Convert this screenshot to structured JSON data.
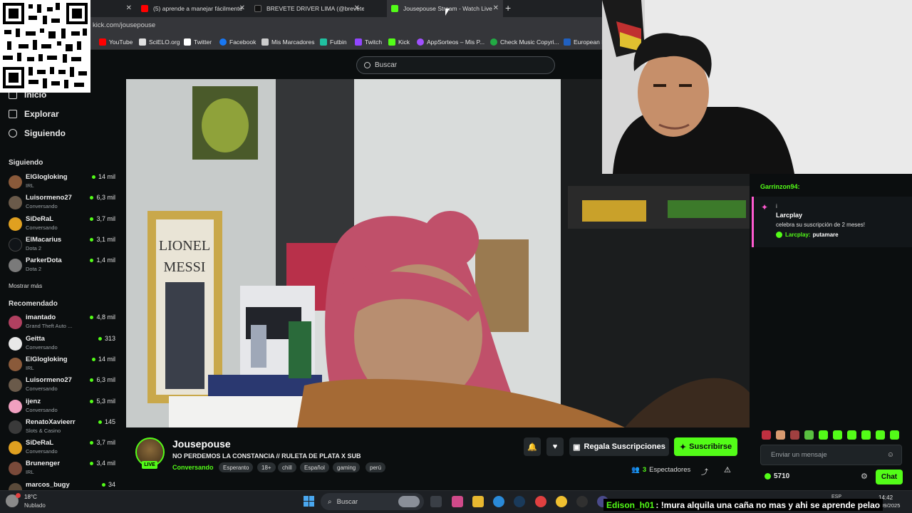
{
  "browser": {
    "tabs": [
      {
        "label": "",
        "favicon_color": "#888888"
      },
      {
        "label": "(5) aprende a manejar fácilmente",
        "favicon_color": "#ff0000"
      },
      {
        "label": "BREVETE DRIVER LIMA (@brevete",
        "favicon_color": "#111111"
      },
      {
        "label": "Jousepouse Stream - Watch Live",
        "favicon_color": "#53fc18",
        "active": true
      }
    ],
    "url": "kick.com/jousepouse",
    "bookmarks": [
      {
        "label": "YouTube",
        "color": "#ff0000"
      },
      {
        "label": "SciELO.org",
        "color": "#e0e0e0"
      },
      {
        "label": "Twitter",
        "color": "#ffffff"
      },
      {
        "label": "Facebook",
        "color": "#1877f2"
      },
      {
        "label": "Mis Marcadores",
        "color": "#cccccc"
      },
      {
        "label": "Futbin",
        "color": "#20c0a0"
      },
      {
        "label": "Twitch",
        "color": "#9146ff"
      },
      {
        "label": "Kick",
        "color": "#53fc18"
      },
      {
        "label": "AppSorteos – Mis P...",
        "color": "#a050ff"
      },
      {
        "label": "Check Music Copyri...",
        "color": "#22aa44"
      },
      {
        "label": "European E",
        "color": "#2060c0"
      }
    ]
  },
  "search": {
    "placeholder": "Buscar"
  },
  "sidebar": {
    "nav": [
      {
        "label": "Inicio",
        "icon": "home-icon"
      },
      {
        "label": "Explorar",
        "icon": "compass-icon"
      },
      {
        "label": "Siguiendo",
        "icon": "heart-icon"
      }
    ],
    "following_title": "Siguiendo",
    "following": [
      {
        "name": "ElGlogloking",
        "category": "IRL",
        "viewers": "14 mil",
        "avatar_color": "#8a5a3a"
      },
      {
        "name": "Luisormeno27",
        "category": "Conversando",
        "viewers": "6,3 mil",
        "avatar_color": "#6a5a4a"
      },
      {
        "name": "SiDeRaL",
        "category": "Conversando",
        "viewers": "3,7 mil",
        "avatar_color": "#e0a020"
      },
      {
        "name": "ElMacarius",
        "category": "Dota 2",
        "viewers": "3,1 mil",
        "avatar_color": "#101418"
      },
      {
        "name": "ParkerDota",
        "category": "Dota 2",
        "viewers": "1,4 mil",
        "avatar_color": "#7a7a7a"
      }
    ],
    "show_more": "Mostrar más",
    "recommended_title": "Recomendado",
    "recommended": [
      {
        "name": "imantado",
        "category": "Grand Theft Auto ...",
        "viewers": "4,8 mil",
        "avatar_color": "#b04060"
      },
      {
        "name": "Geitta",
        "category": "Conversando",
        "viewers": "313",
        "avatar_color": "#e8e8e8"
      },
      {
        "name": "ElGlogloking",
        "category": "IRL",
        "viewers": "14 mil",
        "avatar_color": "#8a5a3a"
      },
      {
        "name": "Luisormeno27",
        "category": "Conversando",
        "viewers": "6,3 mil",
        "avatar_color": "#6a5a4a"
      },
      {
        "name": "ijenz",
        "category": "Conversando",
        "viewers": "5,3 mil",
        "avatar_color": "#f0a0c0"
      },
      {
        "name": "RenatoXavieerr",
        "category": "Slots & Casino",
        "viewers": "145",
        "avatar_color": "#3a3a3a"
      },
      {
        "name": "SiDeRaL",
        "category": "Conversando",
        "viewers": "3,7 mil",
        "avatar_color": "#e0a020"
      },
      {
        "name": "Brunenger",
        "category": "IRL",
        "viewers": "3,4 mil",
        "avatar_color": "#7a4a3a"
      },
      {
        "name": "marcos_bugy",
        "category": "",
        "viewers": "34",
        "avatar_color": "#5a4a3a"
      }
    ]
  },
  "stream": {
    "name": "Jousepouse",
    "title": "NO PERDEMOS LA CONSTANCIA // RULETA DE PLATA X SUB",
    "category": "Conversando",
    "live_label": "LIVE",
    "tags": [
      "Esperanto",
      "18+",
      "chill",
      "Español",
      "gaming",
      "perú"
    ],
    "gift_label": "Regala Suscripciones",
    "subscribe_label": "Suscribirse",
    "viewers_count": "3",
    "viewers_label": "Espectadores"
  },
  "chat": {
    "partial_user": "Garrinzon94:",
    "sub_event": {
      "mark": "i",
      "user": "Larcplay",
      "text": "celebra su suscripción de 2 meses!",
      "msg_user": "Larcplay:",
      "msg_text": "putamare"
    },
    "input_placeholder": "Enviar un mensaje",
    "points": "5710",
    "send_label": "Chat",
    "accent": "#53fc18"
  },
  "taskbar": {
    "weather_temp": "18°C",
    "weather_desc": "Nublado",
    "search_placeholder": "Buscar",
    "tray": "ESP",
    "time": "14:42",
    "date": "8/09/2025"
  },
  "overlay_chat": {
    "user": "Edison_h01",
    "text": ": !mura alquila una caña no mas y ahi se aprende pelao"
  }
}
